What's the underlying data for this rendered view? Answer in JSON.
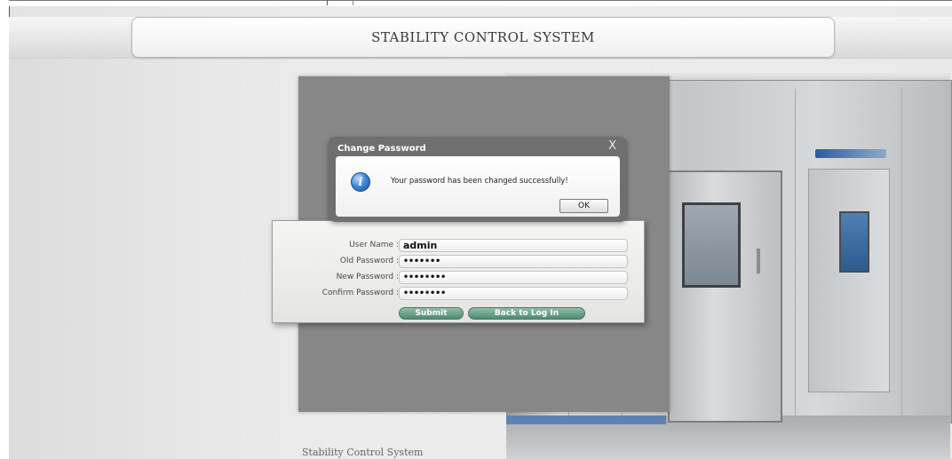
{
  "header": {
    "title": "STABILITY CONTROL SYSTEM"
  },
  "footer": {
    "caption": "Stability Control System"
  },
  "dialog": {
    "title": "Change Password",
    "close_glyph": "X",
    "icon": "info-icon",
    "message": "Your password has been changed successfully!",
    "ok_label": "OK"
  },
  "form": {
    "fields": [
      {
        "label": "User Name :",
        "value": "admin"
      },
      {
        "label": "Old Password :",
        "value": "•••••••"
      },
      {
        "label": "New Password :",
        "value": "••••••••"
      },
      {
        "label": "Confirm Password :",
        "value": "••••••••"
      }
    ],
    "submit_label": "Submit",
    "back_label": "Back to Log In"
  },
  "colors": {
    "backdrop": "#878787",
    "button_green": "#5f9a82",
    "dialog_frame": "#6f6f6f"
  }
}
